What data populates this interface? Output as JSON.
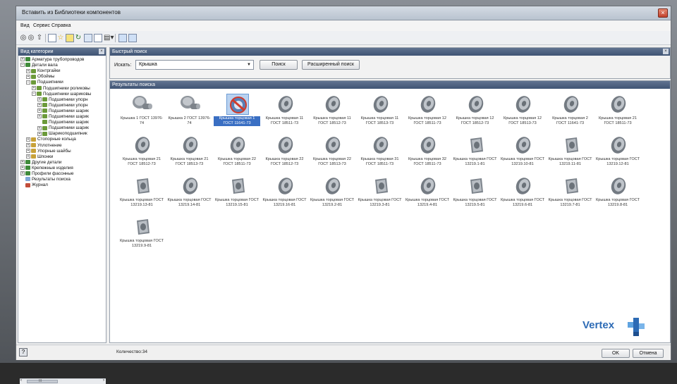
{
  "window": {
    "title": "Вставить из Библиотеки компонентов"
  },
  "menu": [
    "Вид",
    "Сервис",
    "Справка"
  ],
  "toolbar": {
    "icons": [
      "back-icon",
      "forward-icon",
      "up-icon",
      "tree-toggle-icon",
      "favorite-icon",
      "filter-icon",
      "refresh-icon",
      "properties-icon",
      "table-icon",
      "view-mode-icon"
    ]
  },
  "left_pane": {
    "header": "Вид категории",
    "tree": [
      {
        "label": "Арматура трубопроводов",
        "level": 0,
        "pm": "+",
        "color": "#3f8a3a"
      },
      {
        "label": "Детали вала",
        "level": 0,
        "pm": "−",
        "color": "#3f8a3a"
      },
      {
        "label": "Контргайки",
        "level": 1,
        "pm": "+",
        "color": "#6c9a3a"
      },
      {
        "label": "Обоймы",
        "level": 1,
        "pm": "+",
        "color": "#6c9a3a"
      },
      {
        "label": "Подшипники",
        "level": 1,
        "pm": "−",
        "color": "#6c9a3a"
      },
      {
        "label": "Подшипники роликовы",
        "level": 2,
        "pm": "+",
        "color": "#6c9a3a"
      },
      {
        "label": "Подшипники шариковы",
        "level": 2,
        "pm": "−",
        "color": "#6c9a3a"
      },
      {
        "label": "Подшипники упорн",
        "level": 3,
        "pm": "+",
        "color": "#6c9a3a"
      },
      {
        "label": "Подшипники упорн",
        "level": 3,
        "pm": "+",
        "color": "#6c9a3a"
      },
      {
        "label": "Подшипники шарик",
        "level": 3,
        "pm": "+",
        "color": "#6c9a3a"
      },
      {
        "label": "Подшипники шарик",
        "level": 3,
        "pm": "+",
        "color": "#6c9a3a"
      },
      {
        "label": "Подшипники шарик",
        "level": 3,
        "pm": "",
        "color": "#6c9a3a"
      },
      {
        "label": "Подшипники шарик",
        "level": 3,
        "pm": "+",
        "color": "#6c9a3a"
      },
      {
        "label": "Шарикоподшипник",
        "level": 3,
        "pm": "+",
        "color": "#6c9a3a"
      },
      {
        "label": "Стопорные кольца",
        "level": 1,
        "pm": "+",
        "color": "#c8a23a"
      },
      {
        "label": "Уплотнение",
        "level": 1,
        "pm": "+",
        "color": "#c8a23a"
      },
      {
        "label": "Упорные шайбы",
        "level": 1,
        "pm": "+",
        "color": "#c8a23a"
      },
      {
        "label": "Шпонки",
        "level": 1,
        "pm": "+",
        "color": "#c8a23a"
      },
      {
        "label": "Другие детали",
        "level": 0,
        "pm": "+",
        "color": "#3f8a3a"
      },
      {
        "label": "Крепежные изделия",
        "level": 0,
        "pm": "+",
        "color": "#3f8a3a"
      },
      {
        "label": "Профили фасонные",
        "level": 0,
        "pm": "+",
        "color": "#3f8a3a"
      },
      {
        "label": "Результаты поиска",
        "level": 0,
        "pm": "",
        "color": "#7fa7d8"
      },
      {
        "label": "Журнал",
        "level": 0,
        "pm": "",
        "color": "#c24e3a"
      }
    ],
    "scroll_left": "‹",
    "scroll_mid": "III",
    "scroll_right": "›"
  },
  "quick_search": {
    "header": "Быстрый поиск",
    "label": "Искать:",
    "value": "Крышка",
    "search_button": "Поиск",
    "advanced_button": "Расширенный поиск"
  },
  "results": {
    "header": "Результаты поиска",
    "items": [
      {
        "caption": "Крышка 1 ГОСТ 13976-74",
        "shape": "cap"
      },
      {
        "caption": "Крышка 2 ГОСТ 13976-74",
        "shape": "cap"
      },
      {
        "caption": "Крышка торцовая 1 ГОСТ 11641-73",
        "shape": "selected"
      },
      {
        "caption": "Крышка торцовая 11 ГОСТ 18511-73",
        "shape": "ring"
      },
      {
        "caption": "Крышка торцовая 11 ГОСТ 18512-73",
        "shape": "ring"
      },
      {
        "caption": "Крышка торцовая 11 ГОСТ 18513-73",
        "shape": "ring"
      },
      {
        "caption": "Крышка торцовая 12 ГОСТ 18511-73",
        "shape": "ring"
      },
      {
        "caption": "Крышка торцовая 12 ГОСТ 18512-73",
        "shape": "ring"
      },
      {
        "caption": "Крышка торцовая 12 ГОСТ 18513-73",
        "shape": "ring"
      },
      {
        "caption": "Крышка торцовая 2 ГОСТ 11641-73",
        "shape": "ring"
      },
      {
        "caption": "Крышка торцовая 21 ГОСТ 18511-73",
        "shape": "ring"
      },
      {
        "caption": "Крышка торцовая 21 ГОСТ 18512-73",
        "shape": "ring"
      },
      {
        "caption": "Крышка торцовая 21 ГОСТ 18513-73",
        "shape": "ring"
      },
      {
        "caption": "Крышка торцовая 22 ГОСТ 18511-73",
        "shape": "ring"
      },
      {
        "caption": "Крышка торцовая 22 ГОСТ 18512-73",
        "shape": "ring"
      },
      {
        "caption": "Крышка торцовая 22 ГОСТ 18513-73",
        "shape": "ring"
      },
      {
        "caption": "Крышка торцовая 31 ГОСТ 18511-73",
        "shape": "ring"
      },
      {
        "caption": "Крышка торцовая 32 ГОСТ 18511-73",
        "shape": "ring"
      },
      {
        "caption": "Крышка торцовая ГОСТ 13219.1-81",
        "shape": "square"
      },
      {
        "caption": "Крышка торцовая ГОСТ 13219.10-81",
        "shape": "ring"
      },
      {
        "caption": "Крышка торцовая ГОСТ 13219.11-81",
        "shape": "square"
      },
      {
        "caption": "Крышка торцовая ГОСТ 13219.12-81",
        "shape": "ring"
      },
      {
        "caption": "Крышка торцовая ГОСТ 13219.13-81",
        "shape": "square"
      },
      {
        "caption": "Крышка торцовая ГОСТ 13219.14-81",
        "shape": "ring"
      },
      {
        "caption": "Крышка торцовая ГОСТ 13219.15-81",
        "shape": "square"
      },
      {
        "caption": "Крышка торцовая ГОСТ 13219.16-81",
        "shape": "ring"
      },
      {
        "caption": "Крышка торцовая ГОСТ 13219.2-81",
        "shape": "ring"
      },
      {
        "caption": "Крышка торцовая ГОСТ 13219.3-81",
        "shape": "square"
      },
      {
        "caption": "Крышка торцовая ГОСТ 13219.4-81",
        "shape": "ring"
      },
      {
        "caption": "Крышка торцовая ГОСТ 13219.5-81",
        "shape": "square"
      },
      {
        "caption": "Крышка торцовая ГОСТ 13219.6-81",
        "shape": "ring"
      },
      {
        "caption": "Крышка торцовая ГОСТ 13219.7-81",
        "shape": "square"
      },
      {
        "caption": "Крышка торцовая ГОСТ 13219.8-81",
        "shape": "ring"
      },
      {
        "caption": "Крышка торцовая ГОСТ 13219.9-81",
        "shape": "square"
      }
    ]
  },
  "status": {
    "count": "Количество:34",
    "ok_button": "OK",
    "cancel_button": "Отмена",
    "help": "?"
  },
  "logo": {
    "text": "Vertex",
    "mark": "®"
  },
  "colors": {
    "accent": "#3a6fc3",
    "header": "#4f6382",
    "logo": "#2d6bb5"
  }
}
